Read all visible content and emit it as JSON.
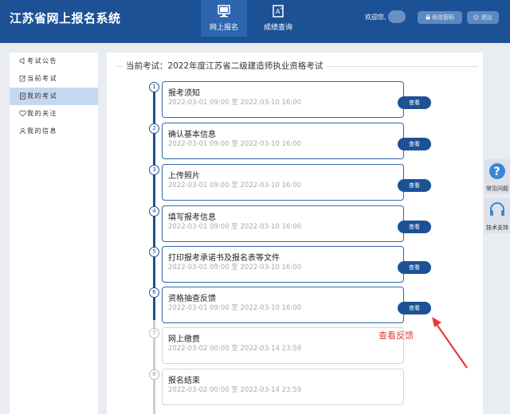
{
  "header": {
    "brand": "江苏省网上报名系统",
    "tabs": [
      {
        "label": "网上报名",
        "icon": "monitor-icon",
        "active": true
      },
      {
        "label": "成绩查询",
        "icon": "grade-icon",
        "active": false
      }
    ],
    "welcome": "欢迎您,",
    "change_password": "修改密码",
    "logout": "退出"
  },
  "sidebar": {
    "items": [
      {
        "label": "考试公告",
        "icon": "megaphone-icon",
        "active": false
      },
      {
        "label": "当前考试",
        "icon": "edit-icon",
        "active": false
      },
      {
        "label": "我的考试",
        "icon": "document-icon",
        "active": true
      },
      {
        "label": "我的关注",
        "icon": "heart-icon",
        "active": false
      },
      {
        "label": "我的信息",
        "icon": "user-icon",
        "active": false
      }
    ]
  },
  "main": {
    "exam_title": "当前考试：2022年度江苏省二级建造师执业资格考试",
    "steps": [
      {
        "num": "1",
        "name": "报考须知",
        "date": "2022-03-01 09:00 至 2022-03-10 16:00",
        "button": "查看",
        "active": true
      },
      {
        "num": "2",
        "name": "确认基本信息",
        "date": "2022-03-01 09:00 至 2022-03-10 16:00",
        "button": "查看",
        "active": true
      },
      {
        "num": "3",
        "name": "上传照片",
        "date": "2022-03-01 09:00 至 2022-03-10 16:00",
        "button": "查看",
        "active": true
      },
      {
        "num": "4",
        "name": "填写报考信息",
        "date": "2022-03-01 09:00 至 2022-03-10 16:00",
        "button": "查看",
        "active": true
      },
      {
        "num": "5",
        "name": "打印报考承诺书及报名表等文件",
        "date": "2022-03-01 09:00 至 2022-03-10 16:00",
        "button": "查看",
        "active": true
      },
      {
        "num": "6",
        "name": "资格抽查反馈",
        "date": "2022-03-01 09:00 至 2022-03-10 16:00",
        "button": "查看",
        "active": true
      },
      {
        "num": "7",
        "name": "网上缴费",
        "date": "2022-03-02 00:00 至 2022-03-14 23:59",
        "button": "",
        "active": false
      },
      {
        "num": "8",
        "name": "报名结束",
        "date": "2022-03-02 00:00 至 2022-03-14 23:59",
        "button": "",
        "active": false
      }
    ],
    "annotation": "查看反馈"
  },
  "floating": {
    "faq": "常见问题",
    "support": "技术支持"
  },
  "colors": {
    "primary": "#1c5295",
    "active_tab": "#2d66ad",
    "sidebar_active": "#c6d8f1",
    "annotation": "#e53b3b"
  }
}
